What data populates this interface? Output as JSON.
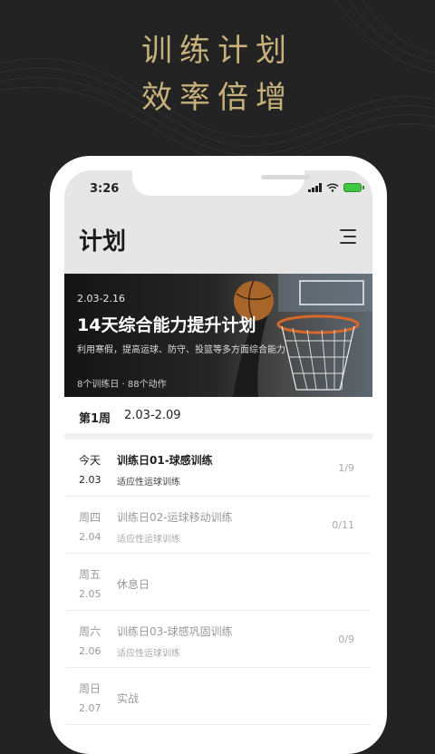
{
  "promo": {
    "line1": "训练计划",
    "line2": "效率倍增"
  },
  "status_bar": {
    "time": "3:26"
  },
  "page": {
    "title": "计划"
  },
  "banner": {
    "date_range": "2.03-2.16",
    "title": "14天综合能力提升计划",
    "description": "利用寒假，提高运球、防守、投篮等多方面综合能力",
    "meta": "8个训练日 · 88个动作"
  },
  "week": {
    "label": "第1周",
    "range": "2.03-2.09"
  },
  "schedule": [
    {
      "day": "今天",
      "date": "2.03",
      "name": "训练日01-球感训练",
      "sub": "适应性运球训练",
      "count": "1/9"
    },
    {
      "day": "周四",
      "date": "2.04",
      "name": "训练日02-运球移动训练",
      "sub": "适应性运球训练",
      "count": "0/11"
    },
    {
      "day": "周五",
      "date": "2.05",
      "name": "休息日",
      "sub": "",
      "count": ""
    },
    {
      "day": "周六",
      "date": "2.06",
      "name": "训练日03-球感巩固训练",
      "sub": "适应性运球训练",
      "count": "0/9"
    },
    {
      "day": "周日",
      "date": "2.07",
      "name": "实战",
      "sub": "",
      "count": ""
    }
  ],
  "colors": {
    "background": "#232323",
    "accent_gold": "#c8b27c",
    "header_gray": "#e6e6e6",
    "battery_green": "#42c742"
  },
  "icons": {
    "menu": "menu-icon",
    "signal": "signal-icon",
    "wifi": "wifi-icon",
    "battery": "battery-charging-icon"
  }
}
